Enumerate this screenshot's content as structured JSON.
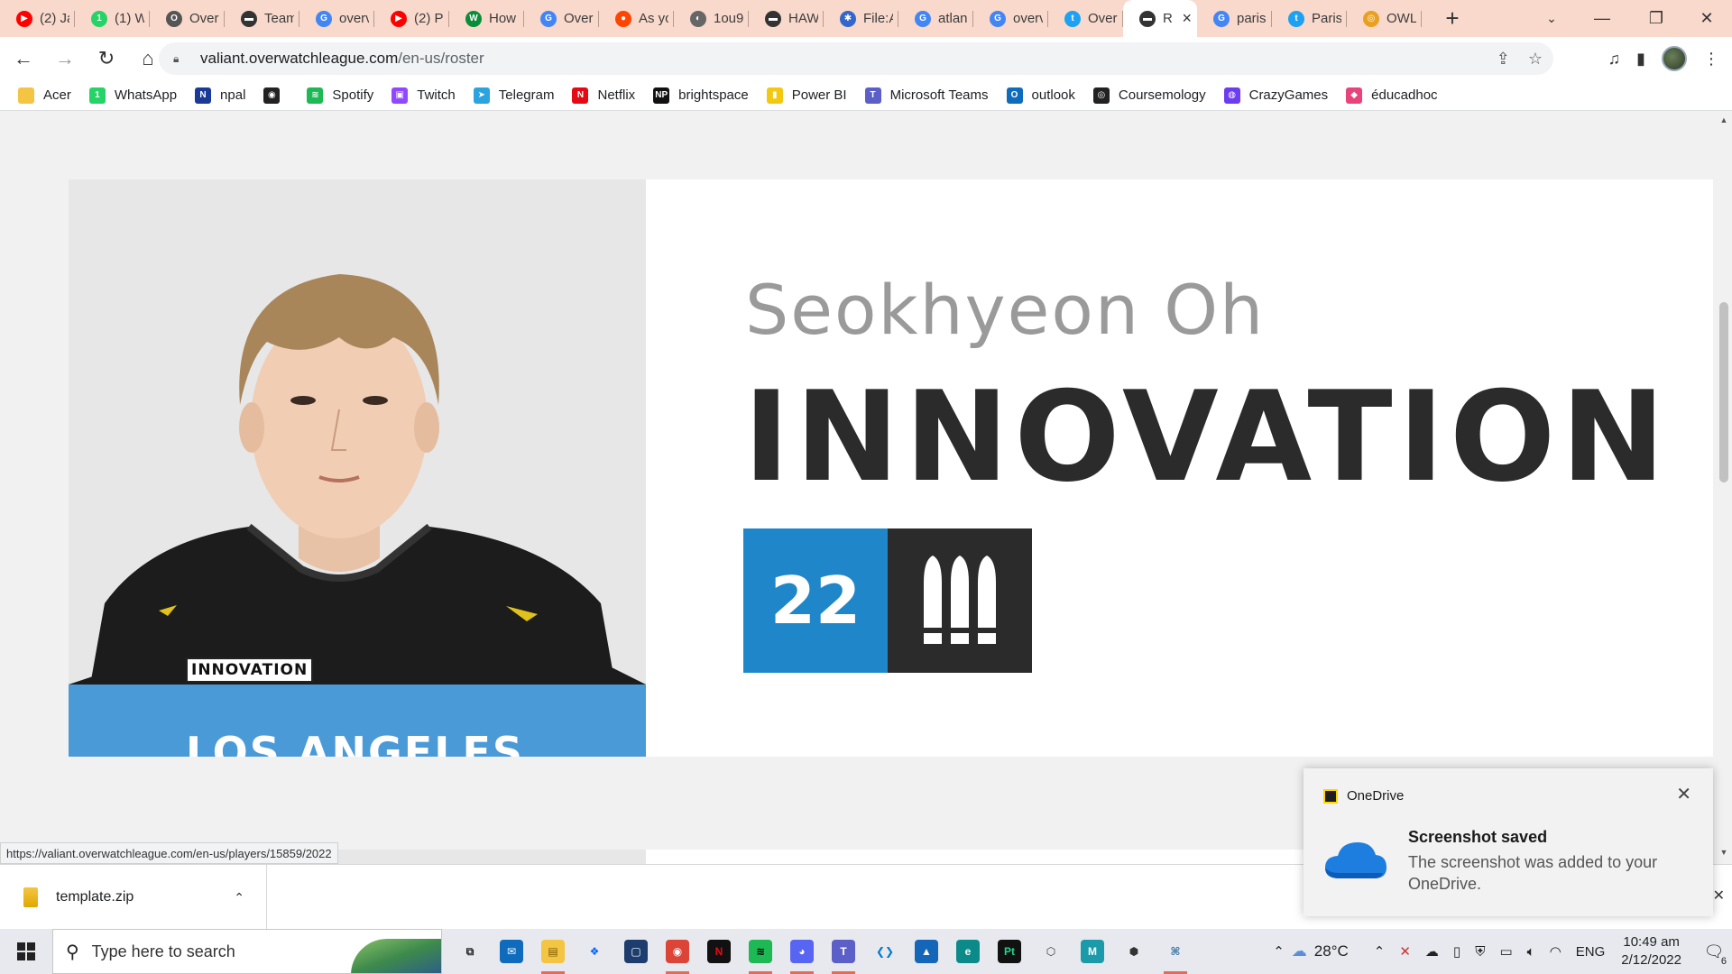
{
  "browser": {
    "tabs": [
      {
        "title": "(2) Ja",
        "color": "#ff0000",
        "glyph": "▶"
      },
      {
        "title": "(1) W",
        "color": "#25d366",
        "glyph": "1"
      },
      {
        "title": "Over",
        "color": "#555555",
        "glyph": "O"
      },
      {
        "title": "Team",
        "color": "#333333",
        "glyph": "▬"
      },
      {
        "title": "overv",
        "color": "#4285f4",
        "glyph": "G"
      },
      {
        "title": "(2) P",
        "color": "#ff0000",
        "glyph": "▶"
      },
      {
        "title": "How",
        "color": "#0a8d3a",
        "glyph": "W"
      },
      {
        "title": "Over",
        "color": "#4285f4",
        "glyph": "G"
      },
      {
        "title": "As yo",
        "color": "#ff4500",
        "glyph": "●"
      },
      {
        "title": "1ou9",
        "color": "#666666",
        "glyph": "◐"
      },
      {
        "title": "HAW",
        "color": "#333333",
        "glyph": "▬"
      },
      {
        "title": "File:A",
        "color": "#3366cc",
        "glyph": "✱"
      },
      {
        "title": "atlan",
        "color": "#4285f4",
        "glyph": "G"
      },
      {
        "title": "overv",
        "color": "#4285f4",
        "glyph": "G"
      },
      {
        "title": "Over",
        "color": "#1da1f2",
        "glyph": "t"
      },
      {
        "title": "R",
        "color": "#333333",
        "glyph": "▬",
        "active": true
      },
      {
        "title": "paris",
        "color": "#4285f4",
        "glyph": "G"
      },
      {
        "title": "Paris",
        "color": "#1da1f2",
        "glyph": "t"
      },
      {
        "title": "OWL",
        "color": "#e8a020",
        "glyph": "◎"
      }
    ],
    "url_host": "valiant.overwatchleague.com",
    "url_path": "/en-us/roster",
    "bookmarks": [
      {
        "label": "Acer",
        "color": "#f4c542",
        "glyph": ""
      },
      {
        "label": "WhatsApp",
        "color": "#25d366",
        "glyph": "1"
      },
      {
        "label": "npal",
        "color": "#1a3a9a",
        "glyph": "N"
      },
      {
        "label": "",
        "color": "#222222",
        "glyph": "◉"
      },
      {
        "label": "Spotify",
        "color": "#1db954",
        "glyph": "≋"
      },
      {
        "label": "Twitch",
        "color": "#9146ff",
        "glyph": "▣"
      },
      {
        "label": "Telegram",
        "color": "#2aa3df",
        "glyph": "➤"
      },
      {
        "label": "Netflix",
        "color": "#e50914",
        "glyph": "N"
      },
      {
        "label": "brightspace",
        "color": "#111111",
        "glyph": "NP"
      },
      {
        "label": "Power BI",
        "color": "#f2c811",
        "glyph": "▮"
      },
      {
        "label": "Microsoft Teams",
        "color": "#5b5fc7",
        "glyph": "T"
      },
      {
        "label": "outlook",
        "color": "#0f6cbd",
        "glyph": "O"
      },
      {
        "label": "Coursemology",
        "color": "#222222",
        "glyph": "◎"
      },
      {
        "label": "CrazyGames",
        "color": "#6c3cf0",
        "glyph": "◍"
      },
      {
        "label": "éducadhoc",
        "color": "#e8437a",
        "glyph": "◆"
      }
    ],
    "status_url": "https://valiant.overwatchleague.com/en-us/players/15859/2022"
  },
  "player": {
    "real_name": "Seokhyeon Oh",
    "handle": "INNOVATION",
    "number": "22",
    "role_icon": "damage-role-icon",
    "jersey_text": "INNOVATION",
    "jersey_team": "LOS ANGELES",
    "colors": {
      "number_bg": "#1f87c9",
      "role_bg": "#2b2b2b",
      "jersey_blue": "#4a9ad8"
    }
  },
  "downloads": {
    "file": "template.zip"
  },
  "toast": {
    "app": "OneDrive",
    "title": "Screenshot saved",
    "body": "The screenshot was added to your OneDrive."
  },
  "taskbar": {
    "search_placeholder": "Type here to search",
    "weather": "28°C",
    "lang": "ENG",
    "time": "10:49 am",
    "date": "2/12/2022",
    "notification_count": "6",
    "apps": [
      {
        "name": "task-view-icon",
        "color": "#e7e9ee",
        "glyph": "⧉",
        "fg": "#222",
        "run": false
      },
      {
        "name": "mail-icon",
        "color": "#0f6cbd",
        "glyph": "✉",
        "fg": "#fff",
        "run": false
      },
      {
        "name": "file-explorer-icon",
        "color": "#f4c542",
        "glyph": "▤",
        "fg": "#7a5a00",
        "run": true
      },
      {
        "name": "dropbox-icon",
        "color": "#e7e9ee",
        "glyph": "❖",
        "fg": "#0061ff",
        "run": false
      },
      {
        "name": "app-blue-icon",
        "color": "#1c3d6e",
        "glyph": "▢",
        "fg": "#fff",
        "run": false
      },
      {
        "name": "chrome-icon",
        "color": "#db4437",
        "glyph": "◉",
        "fg": "#fff",
        "run": true
      },
      {
        "name": "netflix-icon",
        "color": "#111111",
        "glyph": "N",
        "fg": "#e50914",
        "run": false
      },
      {
        "name": "spotify-icon",
        "color": "#1db954",
        "glyph": "≋",
        "fg": "#000",
        "run": true
      },
      {
        "name": "discord-icon",
        "color": "#5865f2",
        "glyph": "◕",
        "fg": "#fff",
        "run": true
      },
      {
        "name": "teams-icon",
        "color": "#5b5fc7",
        "glyph": "T",
        "fg": "#fff",
        "run": true
      },
      {
        "name": "vscode-icon",
        "color": "#e7e9ee",
        "glyph": "❮❯",
        "fg": "#007acc",
        "run": false
      },
      {
        "name": "photos-icon",
        "color": "#1466b8",
        "glyph": "▲",
        "fg": "#fff",
        "run": false
      },
      {
        "name": "edge-icon",
        "color": "#0c8a8a",
        "glyph": "e",
        "fg": "#fff",
        "run": false
      },
      {
        "name": "pycharm-icon",
        "color": "#111111",
        "glyph": "Pt",
        "fg": "#21d789",
        "run": false
      },
      {
        "name": "unity-icon",
        "color": "#e7e9ee",
        "glyph": "⬡",
        "fg": "#333",
        "run": false
      },
      {
        "name": "maya-icon",
        "color": "#1b9aaa",
        "glyph": "M",
        "fg": "#fff",
        "run": false
      },
      {
        "name": "unity-hub-icon",
        "color": "#e7e9ee",
        "glyph": "⬢",
        "fg": "#333",
        "run": false
      },
      {
        "name": "python-icon",
        "color": "#e7e9ee",
        "glyph": "⌘",
        "fg": "#3572a5",
        "run": true
      }
    ]
  }
}
